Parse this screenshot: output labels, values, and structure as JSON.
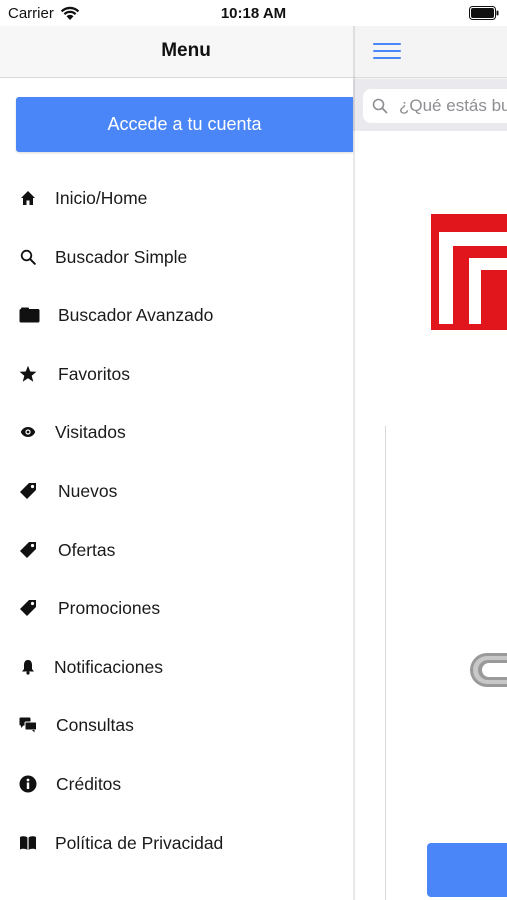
{
  "status_bar": {
    "carrier": "Carrier",
    "time": "10:18 AM"
  },
  "drawer": {
    "title": "Menu",
    "login_button_label": "Accede a tu cuenta",
    "items": [
      {
        "label": "Inicio/Home",
        "icon": "home-icon"
      },
      {
        "label": "Buscador Simple",
        "icon": "search-icon"
      },
      {
        "label": "Buscador Avanzado",
        "icon": "folder-icon"
      },
      {
        "label": "Favoritos",
        "icon": "star-icon"
      },
      {
        "label": "Visitados",
        "icon": "eye-icon"
      },
      {
        "label": "Nuevos",
        "icon": "tag-icon"
      },
      {
        "label": "Ofertas",
        "icon": "tag-icon"
      },
      {
        "label": "Promociones",
        "icon": "tag-icon"
      },
      {
        "label": "Notificaciones",
        "icon": "bell-icon"
      },
      {
        "label": "Consultas",
        "icon": "chat-icon"
      },
      {
        "label": "Créditos",
        "icon": "info-icon"
      },
      {
        "label": "Política de Privacidad",
        "icon": "book-icon"
      }
    ]
  },
  "main": {
    "search_placeholder": "¿Qué estás buscando?",
    "menu_icon": "hamburger-icon"
  },
  "colors": {
    "accent": "#4a86f7",
    "logo_red": "#e0161c"
  }
}
